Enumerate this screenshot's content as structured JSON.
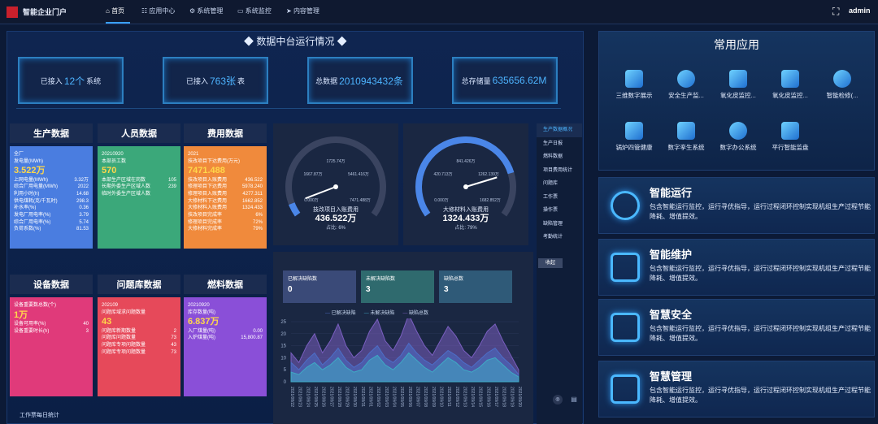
{
  "header": {
    "brand": "智能企业门户",
    "nav": [
      "首页",
      "应用中心",
      "系统管理",
      "系统监控",
      "内容管理"
    ],
    "nav_icons": [
      "home-icon",
      "grid-icon",
      "gear-icon",
      "monitor-icon",
      "send-icon"
    ],
    "user": "admin"
  },
  "datacenter": {
    "title": "◆ 数据中台运行情况 ◆",
    "boxes": [
      {
        "pre": "已接入",
        "val": "12个",
        "post": "系统"
      },
      {
        "pre": "已接入",
        "val": "763张",
        "post": "表"
      },
      {
        "pre": "总数据",
        "val": "2010943432条",
        "post": ""
      },
      {
        "pre": "总存储量",
        "val": "635656.62M",
        "post": ""
      }
    ]
  },
  "modules": {
    "prod": {
      "title": "生产数据",
      "head": "全厂",
      "sub": "发电量(MWh)",
      "big": "3.522万",
      "rows": [
        [
          "上网电量(MWh)",
          "3.32万"
        ],
        [
          "综合厂用电量(MWh)",
          "2022"
        ],
        [
          "利用小时(h)",
          "14.68"
        ],
        [
          "供电煤耗(克/千瓦时)",
          "298.3"
        ],
        [
          "补水率(%)",
          "0.36"
        ],
        [
          "发电厂用电率(%)",
          "3.79"
        ],
        [
          "综合厂用电率(%)",
          "5.74"
        ],
        [
          "负荷系数(%)",
          "81.53"
        ]
      ]
    },
    "staff": {
      "title": "人员数据",
      "head": "20210920",
      "sub": "本部员工数",
      "big": "570",
      "rows": [
        [
          "本部生产区域在岗数",
          "105"
        ],
        [
          "长期外委生产区域人数",
          "239"
        ],
        [
          "临时外委生产区域人数",
          ""
        ]
      ]
    },
    "cost": {
      "title": "费用数据",
      "head": "2021",
      "sub": "技改项目下达费用(万元)",
      "big": "7471.488",
      "rows": [
        [
          "技改项目入账费用",
          "436.522"
        ],
        [
          "修理项目下达费用",
          "5978.240"
        ],
        [
          "修理项目入账费用",
          "4277.311"
        ],
        [
          "大修材料下达费用",
          "1662.852"
        ],
        [
          "大修材料入账费用",
          "1324.433"
        ],
        [
          "技改项目完成率",
          "6%"
        ],
        [
          "修理项目完成率",
          "72%"
        ],
        [
          "大修材料完成率",
          "79%"
        ]
      ]
    },
    "equip": {
      "title": "设备数据",
      "head": "",
      "sub": "设备重要数总数(个)",
      "big": "1万",
      "rows": [
        [
          "设备可用率(%)",
          "40"
        ],
        [
          "设备重要时长(h)",
          "3"
        ]
      ]
    },
    "issue": {
      "title": "问题库数据",
      "head": "202109",
      "sub": "问题库域求问题数量",
      "big": "43",
      "rows": [
        [
          "问题库新期数量",
          "2"
        ],
        [
          "问题库问题数量",
          "73"
        ],
        [
          "问题库专项问题数量",
          "43"
        ],
        [
          "问题库专项问题数量",
          "73"
        ]
      ]
    },
    "fuel": {
      "title": "燃料数据",
      "head": "20210920",
      "sub": "库存数量(吨)",
      "big": "6.837万",
      "rows": [
        [
          "入厂煤量(吨)",
          "0.00"
        ],
        [
          "入炉煤量(吨)",
          "15,800.87"
        ]
      ]
    }
  },
  "gauges": [
    {
      "title": "技改项目入账费用",
      "value": "436.522万",
      "rate": "占比: 6%",
      "ticks": [
        "1725.74万",
        "1667.87万",
        "5461.416万",
        "0.000万",
        "7471.488万"
      ],
      "pct": 0.06
    },
    {
      "title": "大修材料入账费用",
      "value": "1324.433万",
      "rate": "占比: 79%",
      "ticks": [
        "841.426万",
        "420.713万",
        "1262.139万",
        "0.000万",
        "1682.852万"
      ],
      "pct": 0.79
    }
  ],
  "defects": {
    "stats": [
      {
        "label": "已解决缺陷数",
        "value": "0"
      },
      {
        "label": "未解决缺陷数",
        "value": "3"
      },
      {
        "label": "缺陷总数",
        "value": "3"
      }
    ],
    "legend": [
      "已解决缺陷",
      "未解决缺陷",
      "缺陷总数"
    ]
  },
  "chart_data": {
    "type": "area",
    "x": [
      "2021/08/22",
      "2021/08/23",
      "2021/08/24",
      "2021/08/25",
      "2021/08/26",
      "2021/08/27",
      "2021/08/28",
      "2021/08/29",
      "2021/08/30",
      "2021/08/31",
      "2021/09/01",
      "2021/09/02",
      "2021/09/03",
      "2021/09/04",
      "2021/09/05",
      "2021/09/06",
      "2021/09/07",
      "2021/09/08",
      "2021/09/09",
      "2021/09/10",
      "2021/09/11",
      "2021/09/12",
      "2021/09/13",
      "2021/09/14",
      "2021/09/15",
      "2021/09/16",
      "2021/09/17",
      "2021/09/18",
      "2021/09/19",
      "2021/09/20"
    ],
    "ylim": [
      0,
      25
    ],
    "yticks": [
      "0",
      "5",
      "10",
      "15",
      "20",
      "25"
    ],
    "series": [
      {
        "name": "已解决缺陷",
        "values": [
          8,
          5,
          9,
          12,
          7,
          10,
          14,
          9,
          6,
          8,
          12,
          15,
          10,
          8,
          11,
          16,
          12,
          9,
          7,
          10,
          13,
          11,
          8,
          6,
          9,
          12,
          14,
          10,
          7,
          3
        ]
      },
      {
        "name": "未解决缺陷",
        "values": [
          4,
          3,
          6,
          8,
          5,
          7,
          10,
          6,
          4,
          5,
          9,
          11,
          7,
          5,
          8,
          12,
          9,
          6,
          4,
          7,
          10,
          8,
          5,
          4,
          6,
          9,
          10,
          7,
          4,
          2
        ]
      },
      {
        "name": "缺陷总数",
        "values": [
          12,
          8,
          15,
          20,
          12,
          17,
          24,
          15,
          10,
          13,
          21,
          26,
          17,
          13,
          19,
          28,
          21,
          15,
          11,
          17,
          23,
          19,
          13,
          10,
          15,
          21,
          24,
          17,
          11,
          5
        ]
      }
    ],
    "colors": [
      "#4d6ec8",
      "#3fa9c5",
      "#7a5fc0"
    ]
  },
  "menu": [
    "生产数据概况",
    "生产日报",
    "燃料数据",
    "项目费用统计",
    "问题库",
    "工作票",
    "操作票",
    "缺陷管理",
    "考勤统计"
  ],
  "collapse": "收起",
  "work_title": "工作票每日统计",
  "apps": {
    "title": "常用应用",
    "items": [
      "三维数字展示",
      "安全生产监...",
      "氧化皮监控...",
      "氧化皮监控...",
      "智能检修(...",
      "锅炉四管健康",
      "数字孪生系统",
      "数字办公系统",
      "平行智能监盘"
    ]
  },
  "features": [
    {
      "title": "智能运行",
      "desc": "包含智能运行监控，运行寻优指导，运行过程闭环控制实现机组生产过程节能降耗、增值提效。",
      "icon": "circle-target-icon"
    },
    {
      "title": "智能维护",
      "desc": "包含智能运行监控，运行寻优指导，运行过程闭环控制实现机组生产过程节能降耗、增值提效。",
      "icon": "shield-bolt-icon"
    },
    {
      "title": "智慧安全",
      "desc": "包含智能运行监控，运行寻优指导，运行过程闭环控制实现机组生产过程节能降耗、增值提效。",
      "icon": "sliders-icon"
    },
    {
      "title": "智慧管理",
      "desc": "包含智能运行监控，运行寻优指导，运行过程闭环控制实现机组生产过程节能降耗、增值提效。",
      "icon": "layers-icon"
    }
  ]
}
